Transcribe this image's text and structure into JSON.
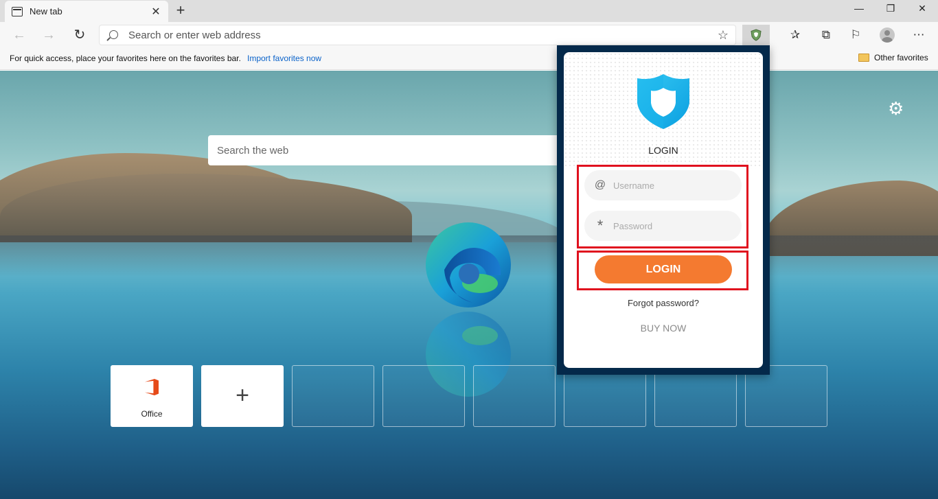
{
  "tab": {
    "title": "New tab"
  },
  "window": {
    "minimize": "—",
    "maximize": "❐",
    "close": "✕"
  },
  "address": {
    "placeholder": "Search or enter web address"
  },
  "favorites_bar": {
    "message": "For quick access, place your favorites here on the favorites bar.",
    "import_link": "Import favorites now",
    "other_favorites": "Other favorites"
  },
  "new_tab_page": {
    "search_placeholder": "Search the web",
    "tiles": [
      {
        "label": "Office"
      }
    ]
  },
  "vpn_popup": {
    "title": "LOGIN",
    "username_placeholder": "Username",
    "password_placeholder": "Password",
    "username_icon": "@",
    "password_icon": "*",
    "login_button": "LOGIN",
    "forgot_password": "Forgot password?",
    "buy_now": "BUY NOW",
    "colors": {
      "accent": "#f47a30",
      "highlight": "#e0101e",
      "frame": "#04294a"
    }
  },
  "icons": {
    "back": "back-arrow-icon",
    "forward": "forward-arrow-icon",
    "refresh": "refresh-icon",
    "favorite": "star-icon",
    "extension": "shield-icon",
    "favorites": "favorites-list-icon",
    "collections": "collections-icon",
    "feedback": "feedback-icon",
    "more": "more-icon",
    "settings": "gear-icon"
  }
}
